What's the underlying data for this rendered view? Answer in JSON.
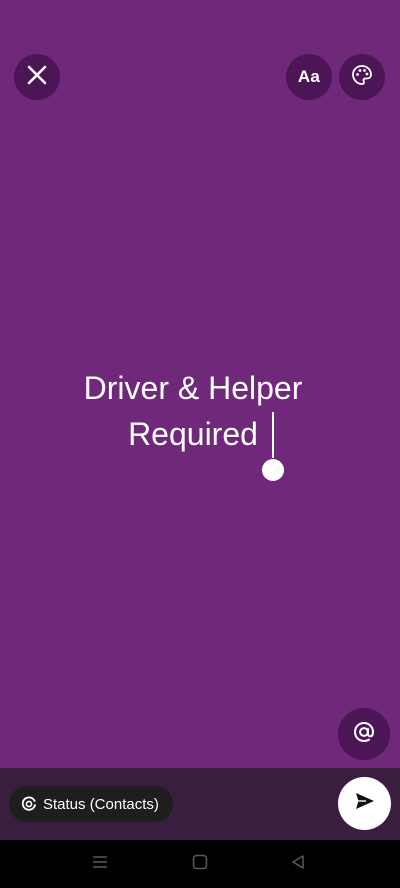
{
  "editor": {
    "background_color": "#6F287A",
    "text": "Driver & Helper\nRequired",
    "toolbar": {
      "close_icon": "close-icon",
      "font_label": "Aa",
      "palette_icon": "palette-icon"
    },
    "mention_icon": "at-icon"
  },
  "bottom_bar": {
    "audience_label": "Status (Contacts)",
    "audience_icon": "status-ring-icon",
    "send_icon": "send-icon"
  },
  "nav": {
    "menu_icon": "menu-icon",
    "home_icon": "home-square-icon",
    "back_icon": "back-triangle-icon"
  }
}
